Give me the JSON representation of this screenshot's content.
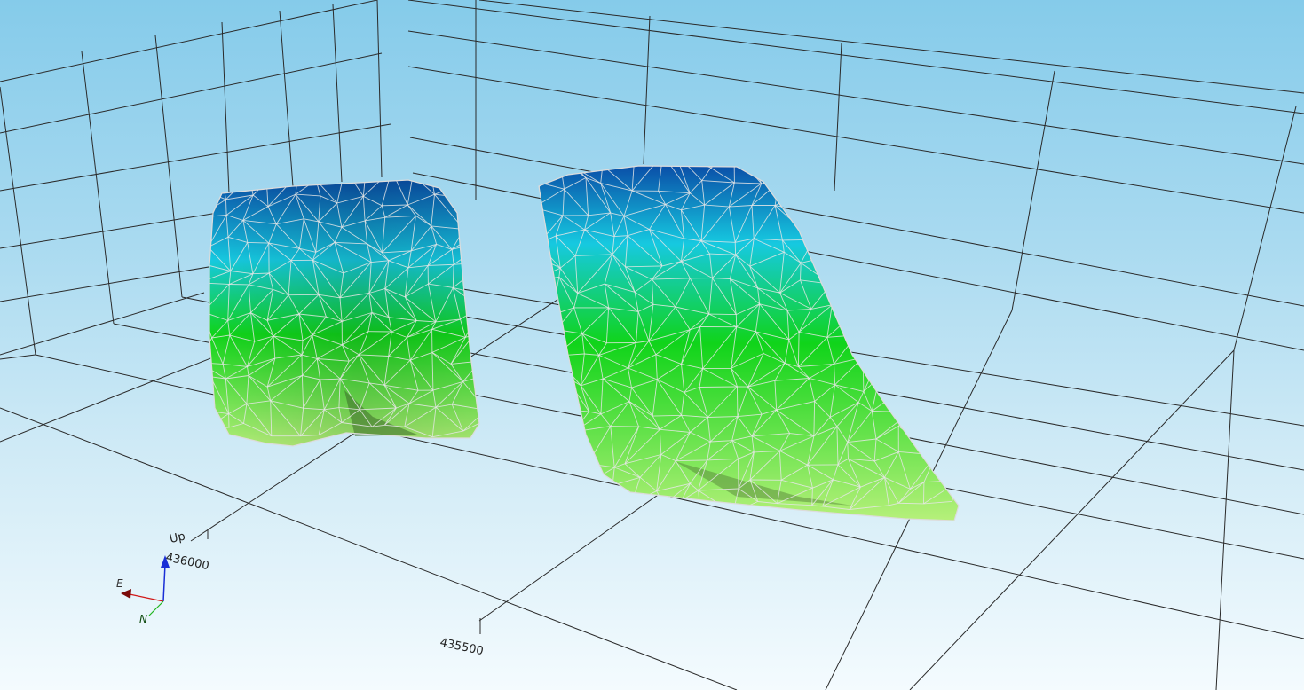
{
  "viewport": {
    "axis_labels": {
      "up": "Up",
      "coord_1": "436000",
      "coord_2": "435500"
    },
    "orientation_triad": {
      "east_label": "E",
      "north_label": "N",
      "colors": {
        "up": "#1a2fd6",
        "east": "#d11a1a",
        "north": "#1fb51f"
      }
    },
    "surface_colors": [
      "#0a4fa8",
      "#16c9e0",
      "#10d41a",
      "#b6f07a"
    ],
    "wireframe_color": "#e6e6e6"
  }
}
